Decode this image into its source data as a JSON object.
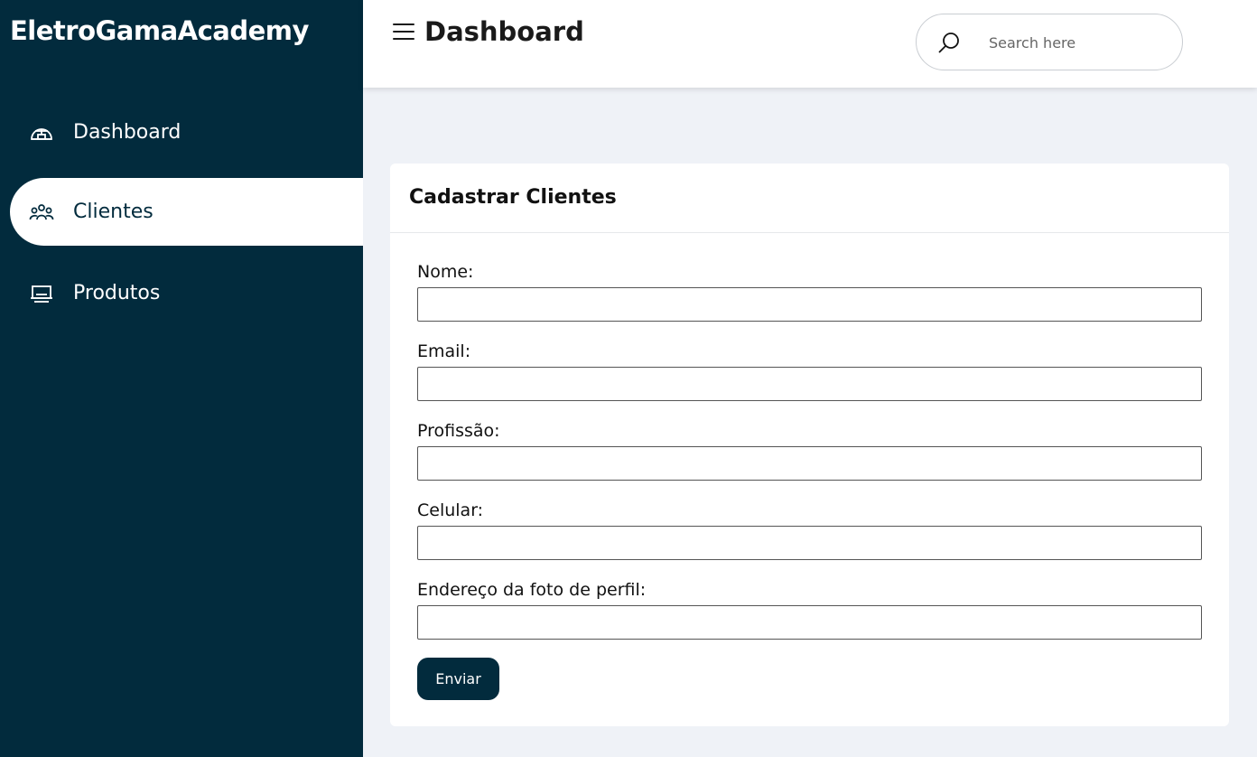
{
  "app": {
    "brand": "EletroGamaAcademy"
  },
  "sidebar": {
    "items": [
      {
        "label": "Dashboard",
        "icon": "dashboard-icon",
        "active": false
      },
      {
        "label": "Clientes",
        "icon": "users-icon",
        "active": true
      },
      {
        "label": "Produtos",
        "icon": "products-icon",
        "active": false
      }
    ]
  },
  "header": {
    "title": "Dashboard",
    "search_placeholder": "Search here"
  },
  "form": {
    "title": "Cadastrar Clientes",
    "fields": [
      {
        "label": "Nome:",
        "value": ""
      },
      {
        "label": "Email:",
        "value": ""
      },
      {
        "label": "Profissão:",
        "value": ""
      },
      {
        "label": "Celular:",
        "value": ""
      },
      {
        "label": "Endereço da foto de perfil:",
        "value": ""
      }
    ],
    "submit_label": "Enviar"
  },
  "colors": {
    "sidebar_bg": "#022b3d",
    "page_bg": "#eff2f7",
    "accent": "#022b3d"
  }
}
